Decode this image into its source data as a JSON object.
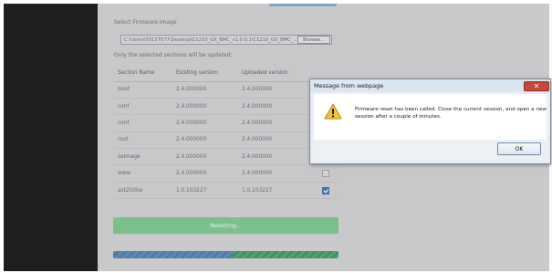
{
  "form": {
    "firmware_label": "Select Firmware Image",
    "file_path": "C:\\Users\\50137577\\Desktop\\C1210_GX_BMC_v1.0.0.1\\C1210_GX_BMC_...",
    "browse_label": "Browse...",
    "sections_label": "Only the selected sections will be updated:"
  },
  "table": {
    "headers": [
      "Section Name",
      "Existing version",
      "Uploaded version"
    ],
    "rows": [
      {
        "name": "boot",
        "existing": "2.4.000000",
        "uploaded": "2.4.000000",
        "checked": false
      },
      {
        "name": "conf",
        "existing": "2.4.000000",
        "uploaded": "2.4.000000",
        "checked": false
      },
      {
        "name": "conf",
        "existing": "2.4.000000",
        "uploaded": "2.4.000000",
        "checked": false
      },
      {
        "name": "root",
        "existing": "2.4.000000",
        "uploaded": "2.4.000000",
        "checked": false
      },
      {
        "name": "osimage",
        "existing": "2.4.000000",
        "uploaded": "2.4.000000",
        "checked": false
      },
      {
        "name": "www",
        "existing": "2.4.000000",
        "uploaded": "2.4.000000",
        "checked": false
      },
      {
        "name": "ast2500e",
        "existing": "1.0.103227",
        "uploaded": "1.0.103227",
        "checked": true
      }
    ]
  },
  "reset_button": "Resetting...",
  "progress": {
    "value": 0.53
  },
  "dialog": {
    "title": "Message from webpage",
    "close_glyph": "✕",
    "icon": "warning-icon",
    "message": "Firmware reset has been called. Close the current session, and open a new session after a couple of minutes.",
    "ok_label": "OK"
  },
  "colors": {
    "sidebar": "#1f1f22",
    "content_bg": "#c9c9cb",
    "reset_button": "#7bbf8b",
    "progress_blue": "#5b88b3",
    "progress_green": "#4ea36e",
    "dialog_close": "#c6463a"
  }
}
